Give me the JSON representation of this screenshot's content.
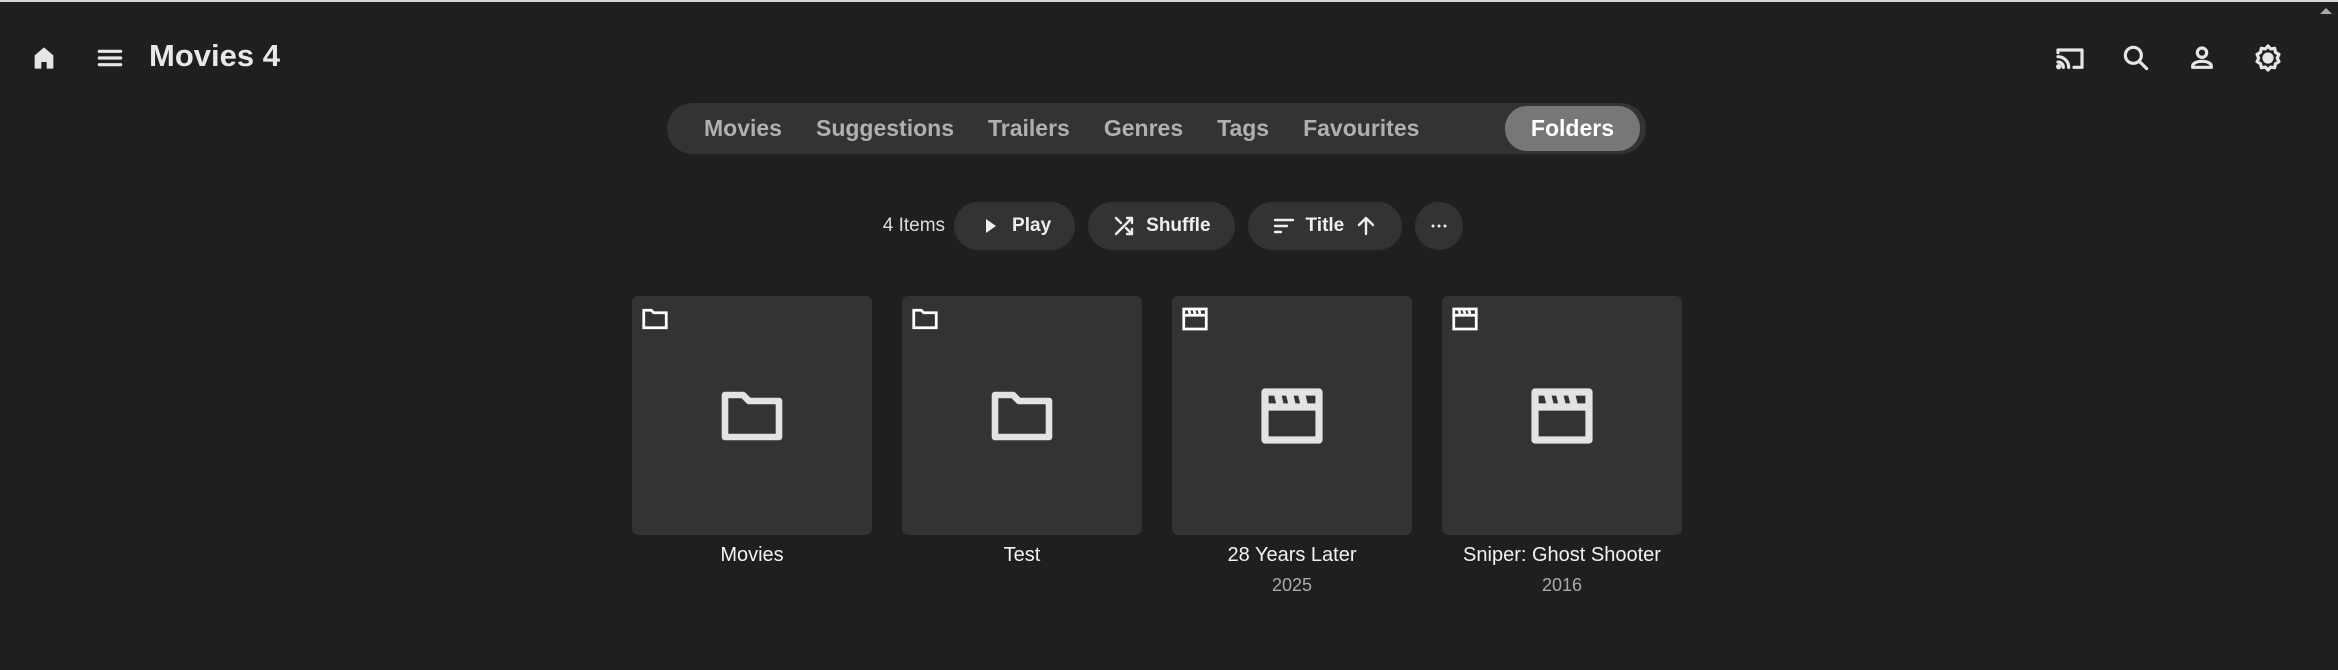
{
  "header": {
    "title": "Movies 4"
  },
  "tabs": [
    {
      "label": "Movies"
    },
    {
      "label": "Suggestions"
    },
    {
      "label": "Trailers"
    },
    {
      "label": "Genres"
    },
    {
      "label": "Tags"
    },
    {
      "label": "Favourites"
    },
    {
      "label": "Folders",
      "active": true
    }
  ],
  "toolbar": {
    "count": "4 Items",
    "play": "Play",
    "shuffle": "Shuffle",
    "sort": "Title"
  },
  "items": [
    {
      "title": "Movies",
      "type": "folder"
    },
    {
      "title": "Test",
      "type": "folder"
    },
    {
      "title": "28 Years Later",
      "year": "2025",
      "type": "movie"
    },
    {
      "title": "Sniper: Ghost Shooter",
      "year": "2016",
      "type": "movie"
    }
  ]
}
